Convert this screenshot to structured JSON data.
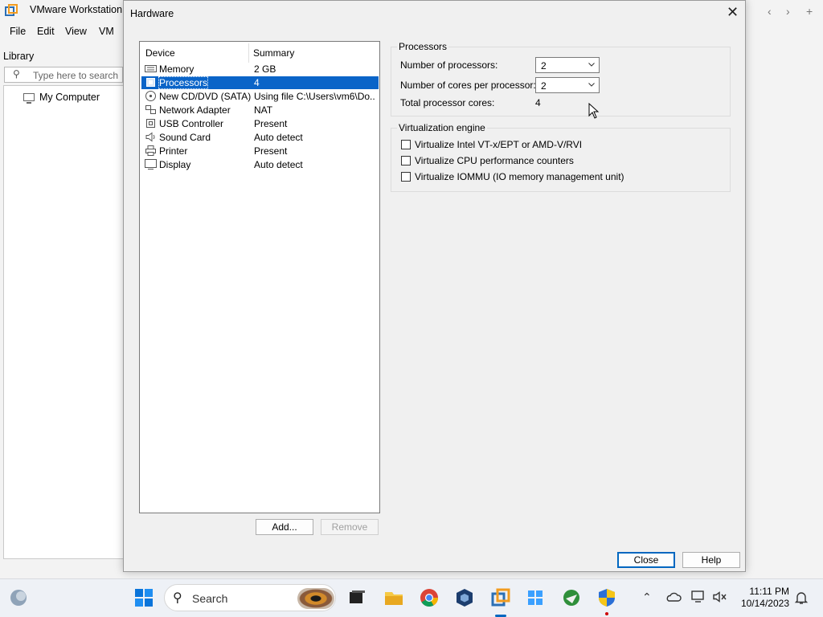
{
  "main_window": {
    "title": "VMware Workstation",
    "menu": [
      "File",
      "Edit",
      "View",
      "VM"
    ],
    "library_label": "Library",
    "search_placeholder": "Type here to search",
    "tree_item": "My Computer",
    "nav": [
      "‹",
      "›",
      "+"
    ]
  },
  "dialog": {
    "title": "Hardware",
    "close_glyph": "✕",
    "columns": {
      "device": "Device",
      "summary": "Summary"
    },
    "devices": [
      {
        "name": "Memory",
        "summary": "2 GB",
        "icon": "memory-icon"
      },
      {
        "name": "Processors",
        "summary": "4",
        "icon": "processor-icon",
        "selected": true
      },
      {
        "name": "New CD/DVD (SATA)",
        "summary": "Using file C:\\Users\\vm6\\Do...",
        "icon": "cd-dvd-icon"
      },
      {
        "name": "Network Adapter",
        "summary": "NAT",
        "icon": "network-adapter-icon"
      },
      {
        "name": "USB Controller",
        "summary": "Present",
        "icon": "usb-controller-icon"
      },
      {
        "name": "Sound Card",
        "summary": "Auto detect",
        "icon": "sound-card-icon"
      },
      {
        "name": "Printer",
        "summary": "Present",
        "icon": "printer-icon"
      },
      {
        "name": "Display",
        "summary": "Auto detect",
        "icon": "display-icon"
      }
    ],
    "add_button": "Add...",
    "remove_button": "Remove",
    "close_button": "Close",
    "help_button": "Help",
    "processors_group": {
      "title": "Processors",
      "num_processors_label": "Number of processors:",
      "num_processors_value": "2",
      "cores_label": "Number of cores per processor:",
      "cores_value": "2",
      "total_label": "Total processor cores:",
      "total_value": "4"
    },
    "virtualization_group": {
      "title": "Virtualization engine",
      "options": [
        {
          "label": "Virtualize Intel VT-x/EPT or AMD-V/RVI",
          "checked": false
        },
        {
          "label": "Virtualize CPU performance counters",
          "checked": false
        },
        {
          "label": "Virtualize IOMMU (IO memory management unit)",
          "checked": false
        }
      ]
    }
  },
  "taskbar": {
    "search_label": "Search",
    "time": "11:11 PM",
    "date": "10/14/2023"
  },
  "colors": {
    "selection": "#0a64c8",
    "accent": "#0067c0"
  }
}
